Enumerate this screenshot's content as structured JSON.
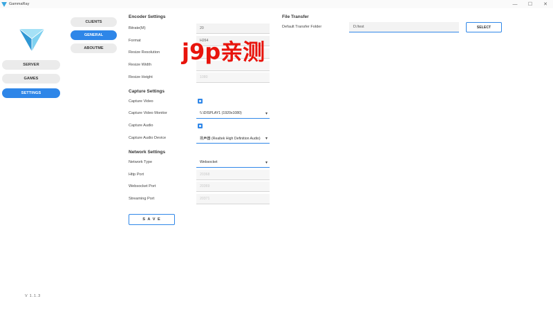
{
  "window": {
    "title": "GammaRay",
    "minimize": "—",
    "maximize": "☐",
    "close": "✕"
  },
  "nav": {
    "items": [
      {
        "label": "SERVER"
      },
      {
        "label": "GAMES"
      },
      {
        "label": "SETTINGS",
        "active": true
      }
    ]
  },
  "subnav": {
    "items": [
      {
        "label": "CLIENTS"
      },
      {
        "label": "GENERAL",
        "active": true
      },
      {
        "label": "ABOUTME"
      }
    ]
  },
  "version": "V 1.1.3",
  "encoder": {
    "title": "Encoder Settings",
    "bitrate": {
      "label": "Bitrate(M)",
      "value": "20"
    },
    "format": {
      "label": "Format",
      "value": "H264"
    },
    "resize_resolution": {
      "label": "Resize Resolution",
      "value": ""
    },
    "resize_width": {
      "label": "Resize Width",
      "value": ""
    },
    "resize_height": {
      "label": "Resize Height",
      "value": "1080"
    }
  },
  "capture": {
    "title": "Capture Settings",
    "video": {
      "label": "Capture Video",
      "checked": true
    },
    "monitor": {
      "label": "Capture Video Monitor",
      "value": "\\\\.\\DISPLAY1 (1920x1080)"
    },
    "audio": {
      "label": "Capture Audio",
      "checked": true
    },
    "audio_device": {
      "label": "Capture Audio Device",
      "value": "扬声器 (Realtek High Definition Audio)"
    }
  },
  "network": {
    "title": "Network Settings",
    "type": {
      "label": "Network Type",
      "value": "Websocket"
    },
    "http_port": {
      "label": "Http Port",
      "value": "20368"
    },
    "websocket_port": {
      "label": "Websocket Port",
      "value": "20369"
    },
    "streaming_port": {
      "label": "Streaming Port",
      "value": "20371"
    }
  },
  "save_label": "S A V E",
  "file_transfer": {
    "title": "File Transfer",
    "folder_label": "Default Transfer Folder",
    "folder_value": "D:/test",
    "select_label": "SELECT"
  },
  "watermark": "j9p亲测",
  "colors": {
    "accent": "#2e86e8",
    "watermark": "#e8140c"
  }
}
